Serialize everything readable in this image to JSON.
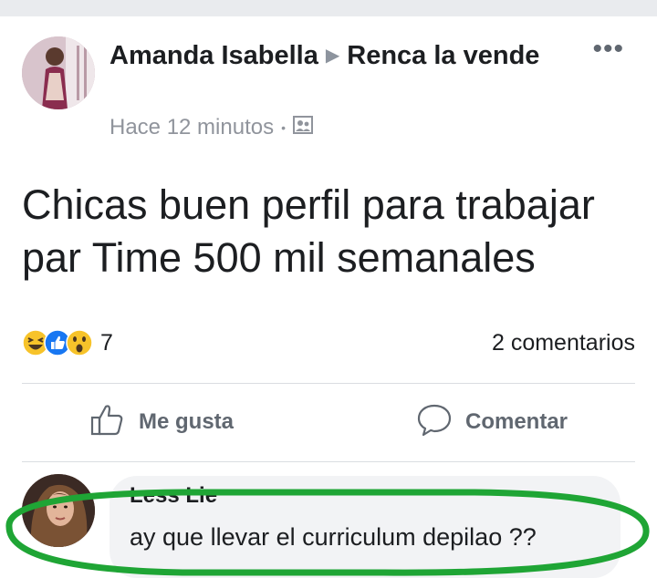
{
  "post": {
    "author": "Amanda Isabella",
    "group": "Renca la vende",
    "time": "Hace 12 minutos",
    "more_icon": "more-options-icon",
    "privacy_icon": "group-photo-icon",
    "text_line1": "Chicas buen perfil para trabajar",
    "text_line2": "par Time 500 mil semanales"
  },
  "reactions": {
    "types": [
      "haha",
      "like",
      "wow"
    ],
    "count": "7",
    "comments": "2 comentarios"
  },
  "actions": {
    "like_label": "Me gusta",
    "comment_label": "Comentar"
  },
  "comment": {
    "author": "Less Lie",
    "text": "ay que llevar el curriculum depilao ??"
  },
  "colors": {
    "like_blue": "#1877f2",
    "reaction_yellow": "#f7c32a",
    "highlight_green": "#1fa535",
    "muted_text": "#606770"
  }
}
